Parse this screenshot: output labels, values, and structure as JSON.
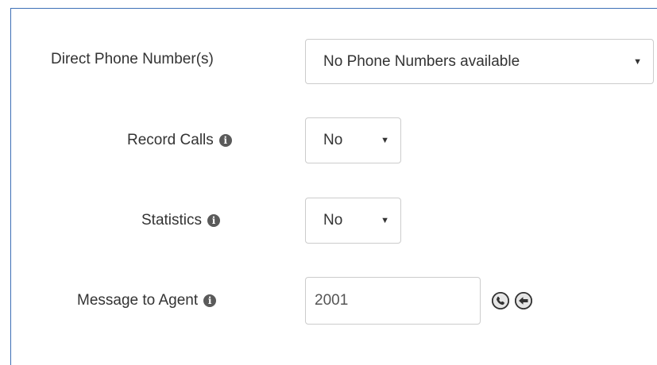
{
  "form": {
    "direct_phone": {
      "label": "Direct Phone Number(s)",
      "value": "No Phone Numbers available"
    },
    "record_calls": {
      "label": "Record Calls",
      "value": "No"
    },
    "statistics": {
      "label": "Statistics",
      "value": "No"
    },
    "message_to_agent": {
      "label": "Message to Agent",
      "value": "2001"
    }
  },
  "icons": {
    "info": "info-icon",
    "call": "phone-icon",
    "back": "arrow-left-icon",
    "dropdown": "caret-down-icon"
  },
  "colors": {
    "frame_border": "#3d6fb6",
    "input_border": "#cccccc",
    "text": "#333333"
  }
}
